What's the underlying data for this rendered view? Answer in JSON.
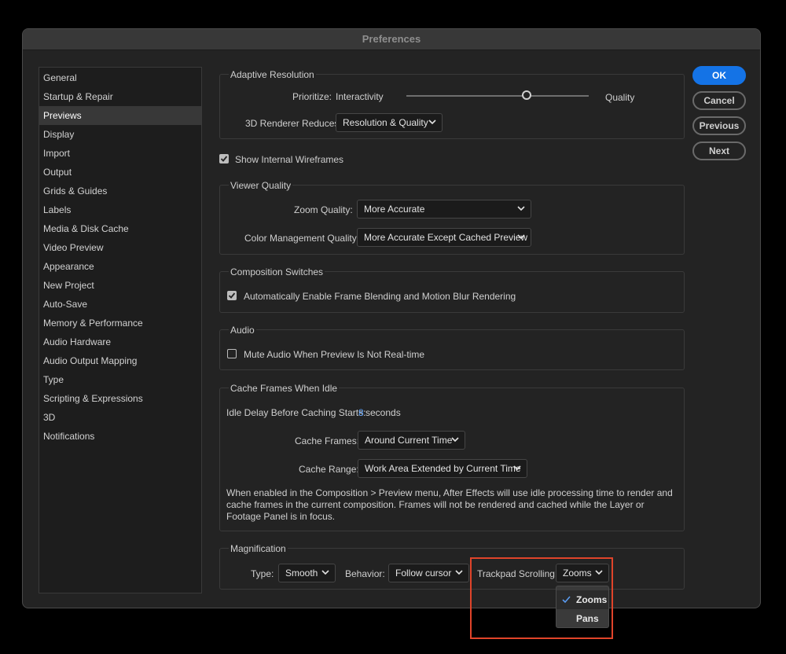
{
  "window": {
    "title": "Preferences"
  },
  "sidebar": {
    "items": [
      {
        "label": "General"
      },
      {
        "label": "Startup & Repair"
      },
      {
        "label": "Previews",
        "selected": true
      },
      {
        "label": "Display"
      },
      {
        "label": "Import"
      },
      {
        "label": "Output"
      },
      {
        "label": "Grids & Guides"
      },
      {
        "label": "Labels"
      },
      {
        "label": "Media & Disk Cache"
      },
      {
        "label": "Video Preview"
      },
      {
        "label": "Appearance"
      },
      {
        "label": "New Project"
      },
      {
        "label": "Auto-Save"
      },
      {
        "label": "Memory & Performance"
      },
      {
        "label": "Audio Hardware"
      },
      {
        "label": "Audio Output Mapping"
      },
      {
        "label": "Type"
      },
      {
        "label": "Scripting & Expressions"
      },
      {
        "label": "3D"
      },
      {
        "label": "Notifications"
      }
    ]
  },
  "buttons": {
    "ok": "OK",
    "cancel": "Cancel",
    "previous": "Previous",
    "next": "Next"
  },
  "adaptive_resolution": {
    "title": "Adaptive Resolution",
    "prioritize_label": "Prioritize:",
    "slider_min_label": "Interactivity",
    "slider_max_label": "Quality",
    "slider_value": 0.66,
    "renderer_label": "3D Renderer Reduces:",
    "renderer_value": "Resolution & Quality"
  },
  "show_wireframes": {
    "label": "Show Internal Wireframes",
    "checked": true
  },
  "viewer_quality": {
    "title": "Viewer Quality",
    "zoom_label": "Zoom Quality:",
    "zoom_value": "More Accurate",
    "color_label": "Color Management Quality:",
    "color_value": "More Accurate Except Cached Preview"
  },
  "composition_switches": {
    "title": "Composition Switches",
    "checkbox_label": "Automatically Enable Frame Blending and Motion Blur Rendering",
    "checked": true
  },
  "audio": {
    "title": "Audio",
    "checkbox_label": "Mute Audio When Preview Is Not Real-time",
    "checked": false
  },
  "cache_frames": {
    "title": "Cache Frames When Idle",
    "idle_label": "Idle Delay Before Caching Starts:",
    "idle_value": "8",
    "idle_unit": "seconds",
    "frames_label": "Cache Frames:",
    "frames_value": "Around Current Time",
    "range_label": "Cache Range:",
    "range_value": "Work Area Extended by Current Time",
    "description": "When enabled in the Composition > Preview menu, After Effects will use idle processing time to render and cache frames in the current composition. Frames will not be rendered and cached while the Layer or Footage Panel is in focus."
  },
  "magnification": {
    "title": "Magnification",
    "type_label": "Type:",
    "type_value": "Smooth",
    "behavior_label": "Behavior:",
    "behavior_value": "Follow cursor",
    "trackpad_label": "Trackpad Scrolling:",
    "trackpad_value": "Zooms",
    "trackpad_options": [
      "Zooms",
      "Pans"
    ],
    "accent": "#e0442a"
  },
  "colors": {
    "primary_button": "#1473e6",
    "highlight": "#e0442a"
  }
}
